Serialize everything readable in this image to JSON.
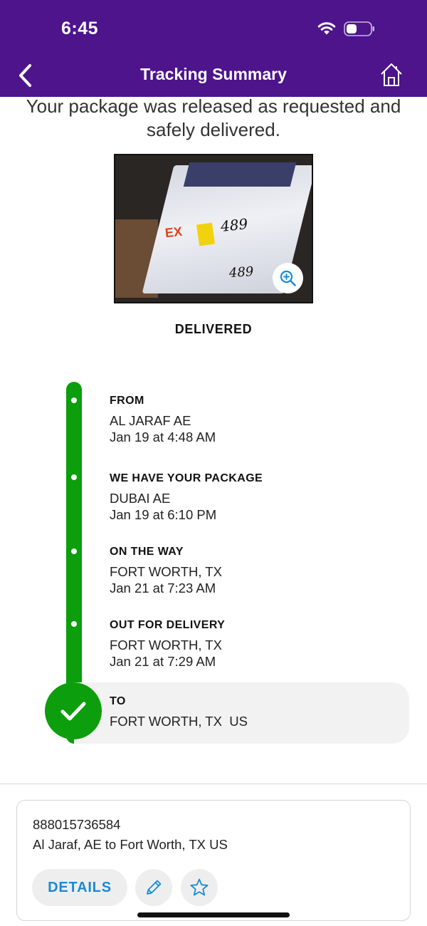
{
  "status_bar": {
    "time": "6:45"
  },
  "header": {
    "title": "Tracking Summary"
  },
  "main": {
    "message": "Your package was released as requested and safely delivered.",
    "photo": {
      "marking_1": "489",
      "marking_2": "489",
      "brand_fragment": "EX"
    },
    "status": "DELIVERED"
  },
  "timeline": [
    {
      "title": "FROM",
      "location": "AL JARAF AE",
      "time": "Jan 19 at 4:48 AM"
    },
    {
      "title": "WE HAVE YOUR PACKAGE",
      "location": "DUBAI AE",
      "time": "Jan 19 at 6:10 PM"
    },
    {
      "title": "ON THE WAY",
      "location": "FORT WORTH, TX",
      "time": "Jan 21 at 7:23 AM"
    },
    {
      "title": "OUT FOR DELIVERY",
      "location": "FORT WORTH, TX",
      "time": "Jan 21 at 7:29 AM"
    },
    {
      "title": "TO",
      "location": "FORT WORTH, TX  US"
    }
  ],
  "card": {
    "tracking_number": "888015736584",
    "route": "Al Jaraf, AE to Fort Worth, TX US",
    "details_label": "DETAILS"
  },
  "colors": {
    "header": "#4d148c",
    "progress": "#0c9e0c",
    "link": "#1a8ad4"
  },
  "icons": [
    "back-icon",
    "home-icon",
    "wifi-icon",
    "battery-icon",
    "zoom-in-icon",
    "checkmark-icon",
    "pencil-icon",
    "star-icon"
  ]
}
